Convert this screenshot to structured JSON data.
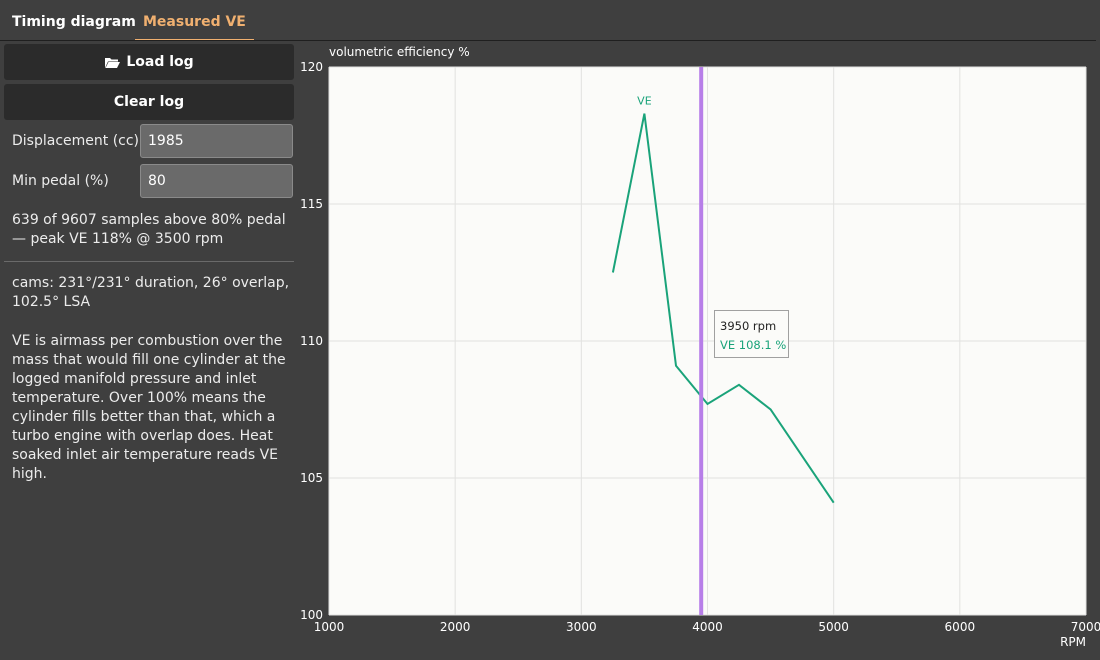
{
  "tabs": [
    {
      "label": "Timing diagram"
    },
    {
      "label": "Measured VE"
    }
  ],
  "panel": {
    "load_label": "Load log",
    "clear_label": "Clear log",
    "displacement_label": "Displacement (cc)",
    "displacement_value": "1985",
    "pedal_label": "Min pedal (%)",
    "pedal_value": "80",
    "summary": "639 of 9607 samples above 80% pedal — peak VE 118% @ 3500 rpm",
    "cams": "cams: 231°/231° duration, 26° overlap, 102.5° LSA",
    "explanation": "VE is airmass per combustion over the mass that would fill one cylinder at the logged manifold pressure and inlet temperature. Over 100% means the cylinder fills better than that, which a turbo engine with overlap does. Heat soaked inlet air temperature reads VE high."
  },
  "tooltip": {
    "rpm": "3950 rpm",
    "ve": "VE  108.1 %"
  },
  "colors": {
    "series": "#1aa37a",
    "cursor": "#b77ee8",
    "accent": "#f0b070"
  },
  "chart_data": {
    "type": "line",
    "ylabel": "volumetric efficiency %",
    "xlabel": "RPM",
    "xlim": [
      1000,
      7000
    ],
    "ylim": [
      100,
      120
    ],
    "x_ticks": [
      1000,
      2000,
      3000,
      4000,
      5000,
      6000,
      7000
    ],
    "y_ticks": [
      100,
      105,
      110,
      115,
      120
    ],
    "grid": true,
    "cursor_x": 3950,
    "series": [
      {
        "name": "VE",
        "x": [
          3250,
          3500,
          3750,
          4000,
          4250,
          4500,
          5000
        ],
        "y": [
          112.5,
          118.3,
          109.1,
          107.7,
          108.4,
          107.5,
          104.1
        ]
      }
    ]
  }
}
